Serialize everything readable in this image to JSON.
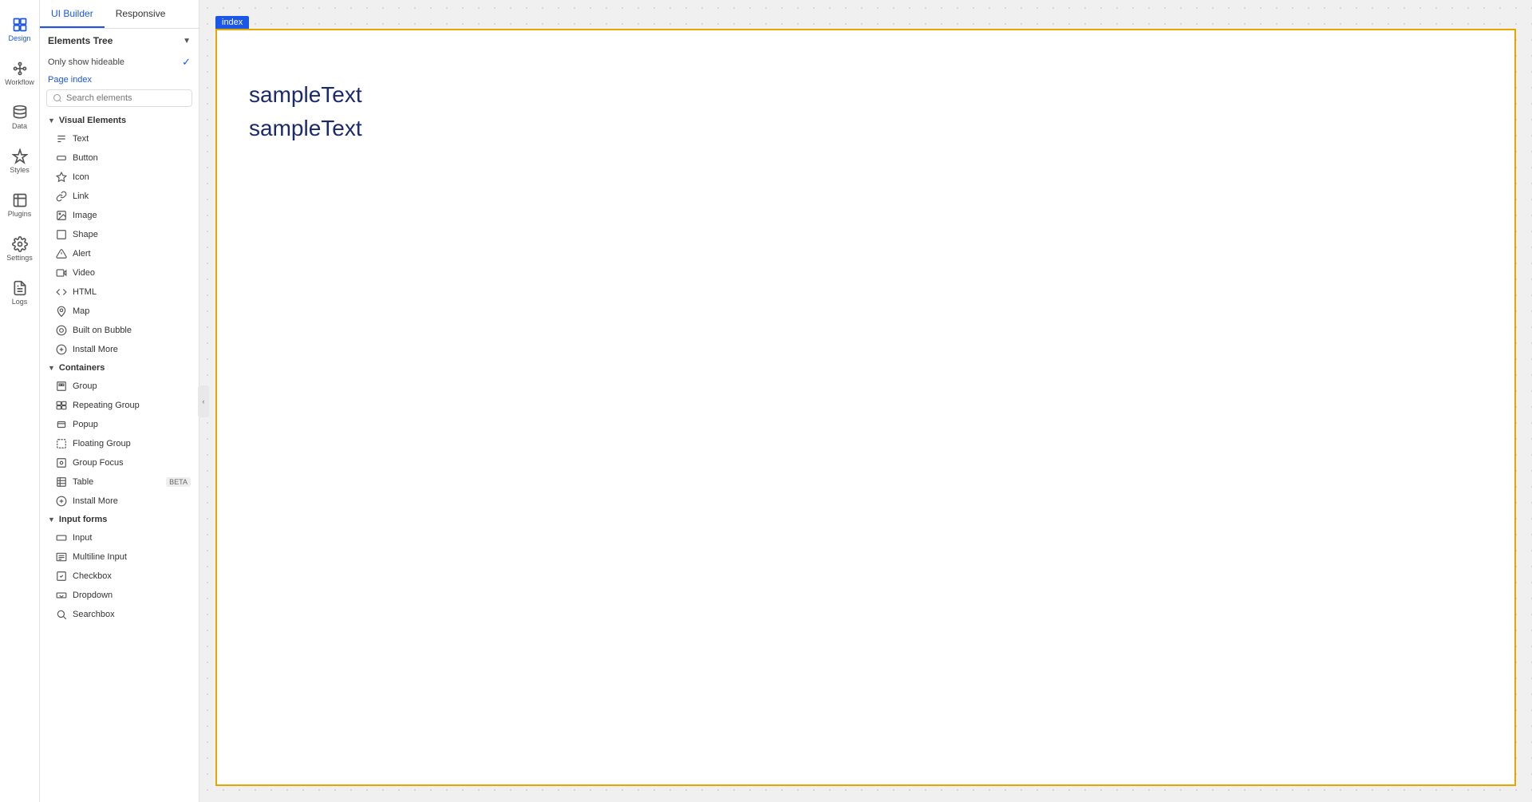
{
  "topTabs": {
    "uiBuilder": "UI Builder",
    "responsive": "Responsive"
  },
  "leftNav": {
    "items": [
      {
        "id": "design",
        "label": "Design",
        "active": true
      },
      {
        "id": "workflow",
        "label": "Workflow",
        "active": false
      },
      {
        "id": "data",
        "label": "Data",
        "active": false
      },
      {
        "id": "styles",
        "label": "Styles",
        "active": false
      },
      {
        "id": "plugins",
        "label": "Plugins",
        "active": false
      },
      {
        "id": "settings",
        "label": "Settings",
        "active": false
      },
      {
        "id": "logs",
        "label": "Logs",
        "active": false
      }
    ]
  },
  "elementsTree": {
    "header": "Elements Tree",
    "onlyShowHideable": "Only show hideable",
    "pageIndex": "Page index",
    "searchPlaceholder": "Search elements"
  },
  "visualElements": {
    "sectionLabel": "Visual Elements",
    "items": [
      {
        "id": "text",
        "label": "Text"
      },
      {
        "id": "button",
        "label": "Button"
      },
      {
        "id": "icon",
        "label": "Icon"
      },
      {
        "id": "link",
        "label": "Link"
      },
      {
        "id": "image",
        "label": "Image"
      },
      {
        "id": "shape",
        "label": "Shape"
      },
      {
        "id": "alert",
        "label": "Alert"
      },
      {
        "id": "video",
        "label": "Video"
      },
      {
        "id": "html",
        "label": "HTML"
      },
      {
        "id": "map",
        "label": "Map"
      },
      {
        "id": "builtonbubble",
        "label": "Built on Bubble"
      },
      {
        "id": "installmore-visual",
        "label": "Install More"
      }
    ]
  },
  "containers": {
    "sectionLabel": "Containers",
    "items": [
      {
        "id": "group",
        "label": "Group",
        "beta": false
      },
      {
        "id": "repeatinggroup",
        "label": "Repeating Group",
        "beta": false
      },
      {
        "id": "popup",
        "label": "Popup",
        "beta": false
      },
      {
        "id": "floatinggroup",
        "label": "Floating Group",
        "beta": false
      },
      {
        "id": "groupfocus",
        "label": "Group Focus",
        "beta": false
      },
      {
        "id": "table",
        "label": "Table",
        "beta": true
      },
      {
        "id": "installmore-container",
        "label": "Install More",
        "beta": false
      }
    ]
  },
  "inputForms": {
    "sectionLabel": "Input forms",
    "items": [
      {
        "id": "input",
        "label": "Input"
      },
      {
        "id": "multilineinput",
        "label": "Multiline Input"
      },
      {
        "id": "checkbox",
        "label": "Checkbox"
      },
      {
        "id": "dropdown",
        "label": "Dropdown"
      },
      {
        "id": "searchbox",
        "label": "Searchbox"
      }
    ]
  },
  "canvas": {
    "pageTab": "index",
    "sampleText1": "sampleText",
    "sampleText2": "sampleText"
  }
}
